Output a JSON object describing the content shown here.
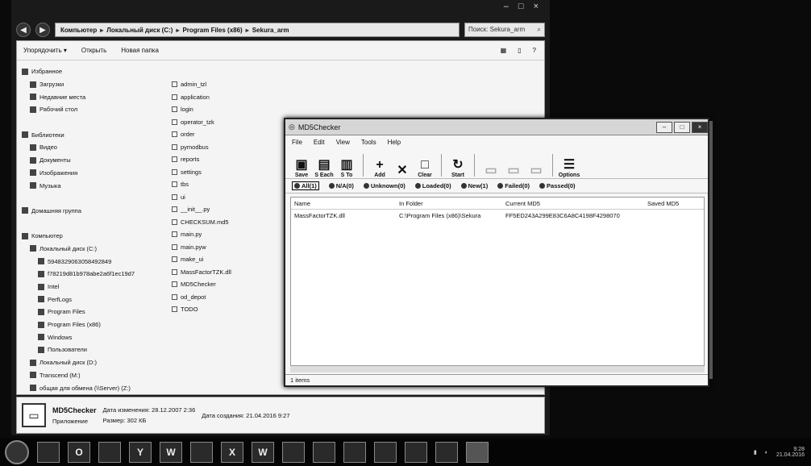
{
  "explorer": {
    "window_controls": [
      "–",
      "□",
      "×"
    ],
    "back_label": "◀",
    "forward_label": "▶",
    "breadcrumb": [
      "Компьютер",
      "Локальный диск (C:)",
      "Program Files (x86)",
      "Sekura_arm"
    ],
    "search_placeholder": "Поиск: Sekura_arm",
    "toolbar": {
      "organize": "Упорядочить ▾",
      "open": "Открыть",
      "new_folder": "Новая папка"
    },
    "nav": [
      {
        "label": "Избранное",
        "indent": 0
      },
      {
        "label": "Загрузки",
        "indent": 1
      },
      {
        "label": "Недавние места",
        "indent": 1
      },
      {
        "label": "Рабочий стол",
        "indent": 1
      },
      {
        "label": "",
        "indent": 0
      },
      {
        "label": "Библиотеки",
        "indent": 0
      },
      {
        "label": "Видео",
        "indent": 1
      },
      {
        "label": "Документы",
        "indent": 1
      },
      {
        "label": "Изображения",
        "indent": 1
      },
      {
        "label": "Музыка",
        "indent": 1
      },
      {
        "label": "",
        "indent": 0
      },
      {
        "label": "Домашняя группа",
        "indent": 0
      },
      {
        "label": "",
        "indent": 0
      },
      {
        "label": "Компьютер",
        "indent": 0
      },
      {
        "label": "Локальный диск (C:)",
        "indent": 1
      },
      {
        "label": "5948329063058492849",
        "indent": 2
      },
      {
        "label": "f78219d81b978abe2a6f1ec19d7",
        "indent": 2
      },
      {
        "label": "Intel",
        "indent": 2
      },
      {
        "label": "PerfLogs",
        "indent": 2
      },
      {
        "label": "Program Files",
        "indent": 2
      },
      {
        "label": "Program Files (x86)",
        "indent": 2
      },
      {
        "label": "Windows",
        "indent": 2
      },
      {
        "label": "Пользователи",
        "indent": 2
      },
      {
        "label": "Локальный диск (D:)",
        "indent": 1
      },
      {
        "label": "Transcend (M:)",
        "indent": 1
      },
      {
        "label": "общая для обмена (\\\\Server) (Z:)",
        "indent": 1
      }
    ],
    "files": [
      "admin_tzl",
      "application",
      "login",
      "operator_tzk",
      "order",
      "pymodbus",
      "reports",
      "settings",
      "tbs",
      "ui",
      "__init__.py",
      "CHECKSUM.md5",
      "main.py",
      "main.pyw",
      "make_ui",
      "MassFactorTZK.dll",
      "MD5Checker",
      "od_depot",
      "TODO"
    ],
    "status": {
      "name": "MD5Checker",
      "modified_label": "Дата изменения: 28.12.2007 2:36",
      "created_label": "Дата создания: 21.04.2016 9:27",
      "type_label": "Приложение",
      "size_label": "Размер: 302 КБ"
    }
  },
  "md5": {
    "title": "MD5Checker",
    "controls": [
      "–",
      "□",
      "×"
    ],
    "menu": [
      "File",
      "Edit",
      "View",
      "Tools",
      "Help"
    ],
    "toolbar": [
      {
        "label": "Save",
        "glyph": "▣",
        "enabled": true
      },
      {
        "label": "S Each",
        "glyph": "▤",
        "enabled": true
      },
      {
        "label": "S To",
        "glyph": "▥",
        "enabled": true
      },
      {
        "label": "Add",
        "glyph": "+",
        "enabled": true
      },
      {
        "label": "",
        "glyph": "✕",
        "enabled": true
      },
      {
        "label": "Clear",
        "glyph": "□",
        "enabled": true
      },
      {
        "label": "Start",
        "glyph": "↻",
        "enabled": true
      },
      {
        "label": "",
        "glyph": "▭",
        "enabled": false
      },
      {
        "label": "",
        "glyph": "▭",
        "enabled": false
      },
      {
        "label": "",
        "glyph": "▭",
        "enabled": false
      },
      {
        "label": "Options",
        "glyph": "☰",
        "enabled": true
      }
    ],
    "filters": [
      {
        "label": "All(1)",
        "active": true
      },
      {
        "label": "N/A(0)",
        "active": false
      },
      {
        "label": "Unknown(0)",
        "active": false
      },
      {
        "label": "Loaded(0)",
        "active": false
      },
      {
        "label": "New(1)",
        "active": false
      },
      {
        "label": "Failed(0)",
        "active": false
      },
      {
        "label": "Passed(0)",
        "active": false
      }
    ],
    "columns": [
      "Name",
      "In Folder",
      "Current MD5",
      "Saved MD5"
    ],
    "rows": [
      {
        "name": "MassFactorTZK.dll",
        "folder": "C:\\Program Files (x86)\\Sekura",
        "current": "FF5ED243A299E83C6A8C4198F4298070",
        "saved": ""
      }
    ],
    "status": "1 items"
  },
  "taskbar": {
    "apps": [
      "",
      "O",
      "",
      "Y",
      "W",
      "",
      "X",
      "W",
      "",
      "",
      "",
      "",
      "",
      "",
      ""
    ],
    "time": "9:28",
    "date": "21.04.2016"
  }
}
